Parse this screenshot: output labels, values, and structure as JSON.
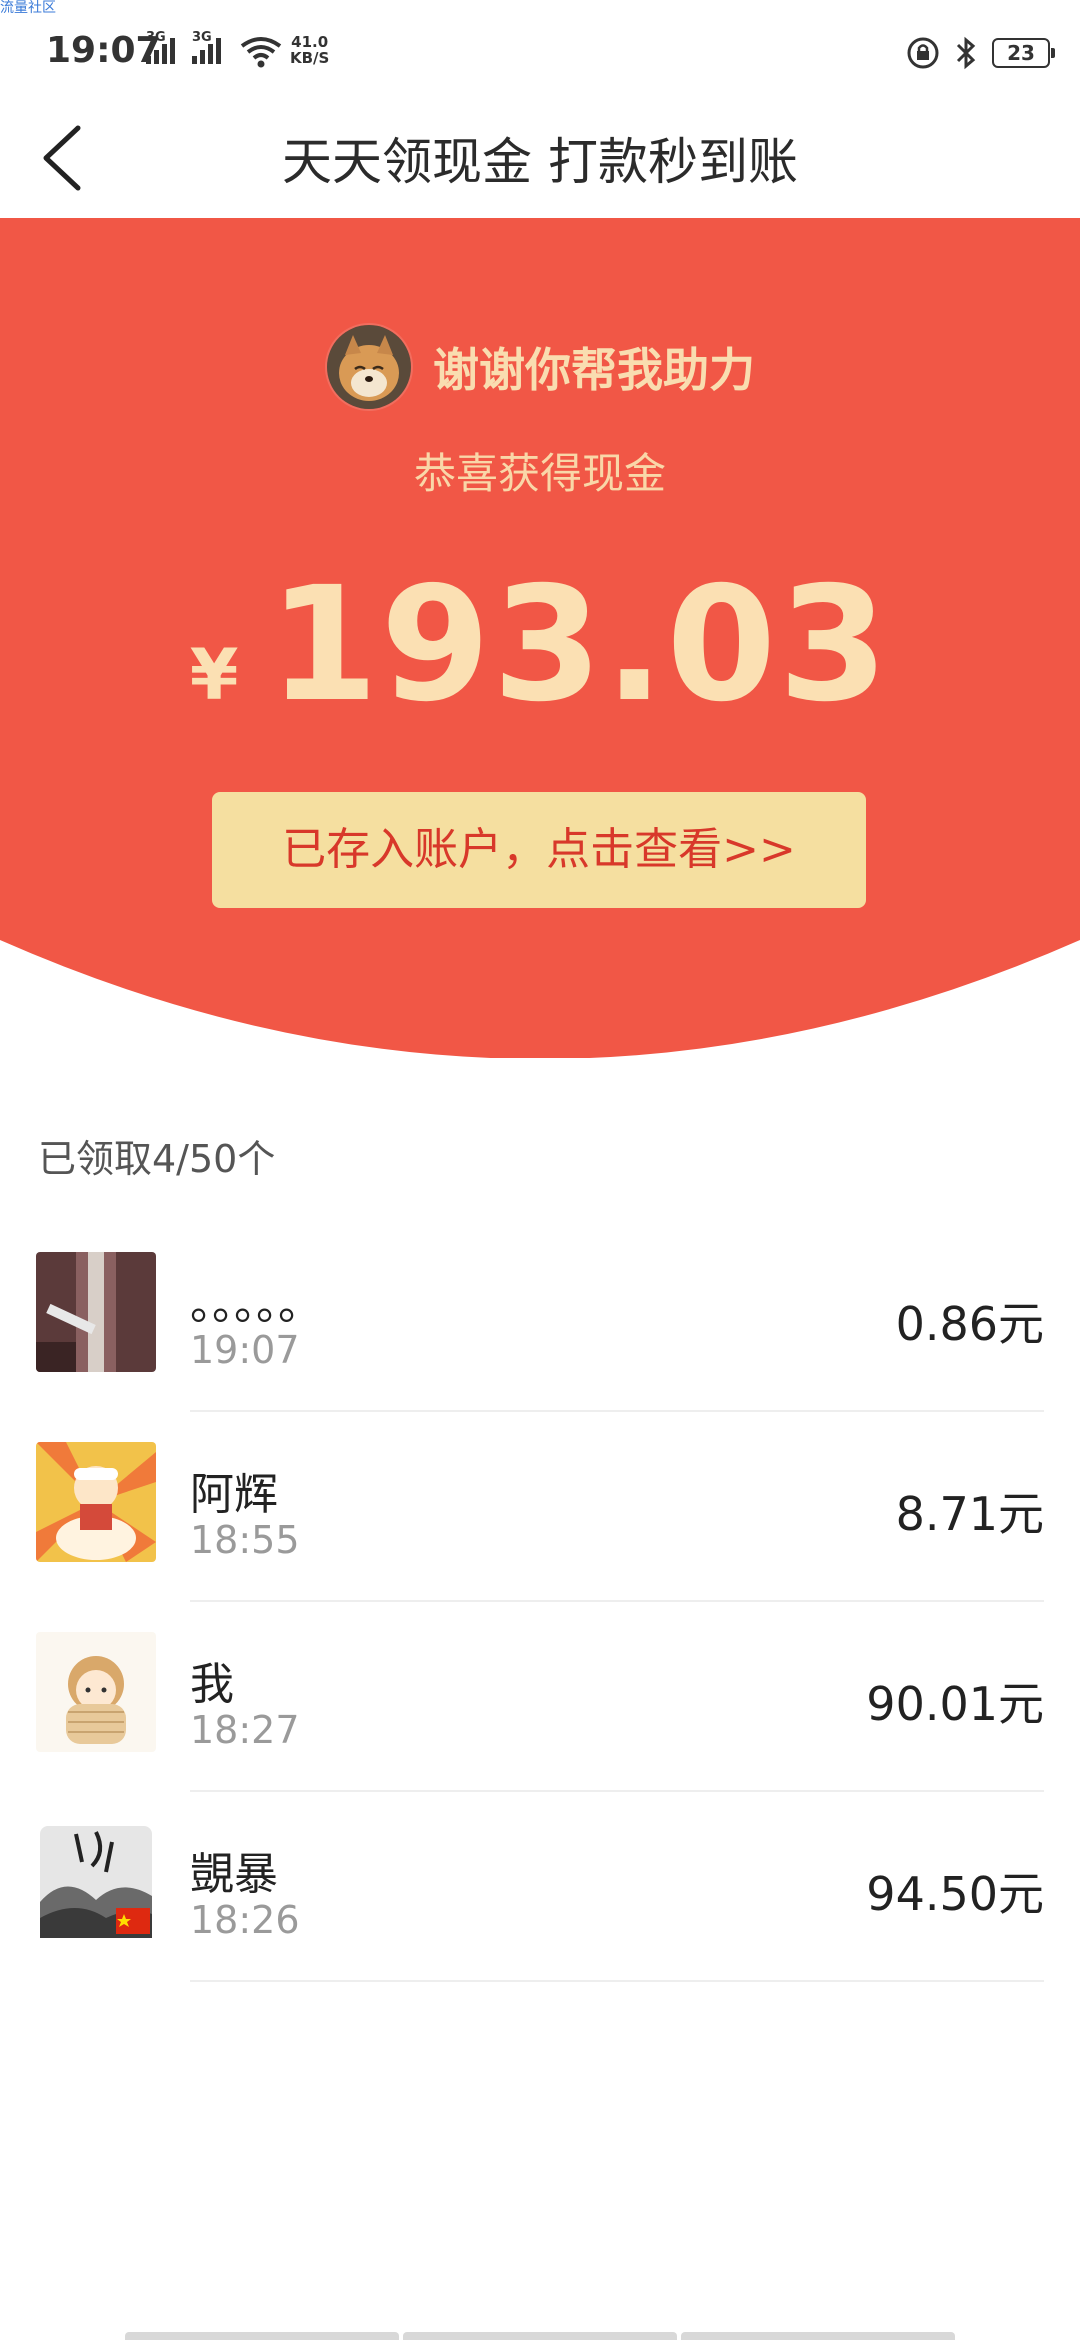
{
  "watermark": "流量社区",
  "status_bar": {
    "time": "19:07",
    "signal1_label": "3G",
    "signal2_label": "3G",
    "speed_value": "41.0",
    "speed_unit": "KB/S",
    "battery": "23"
  },
  "header": {
    "title": "天天领现金 打款秒到账"
  },
  "hero": {
    "thanks_text": "谢谢你帮我助力",
    "subtitle": "恭喜获得现金",
    "currency": "¥",
    "amount": "193.03",
    "view_button_label": "已存入账户，点击查看>>"
  },
  "list": {
    "received_label": "已领取4/50个",
    "items": [
      {
        "name": "。。。。。",
        "time": "19:07",
        "amount": "0.86元"
      },
      {
        "name": "阿辉",
        "time": "18:55",
        "amount": "8.71元"
      },
      {
        "name": "我",
        "time": "18:27",
        "amount": "90.01元"
      },
      {
        "name": "覬暴",
        "time": "18:26",
        "amount": "94.50元"
      }
    ]
  },
  "colors": {
    "hero_red": "#f15746",
    "gold_text": "#fbe0b3",
    "button_bg": "#f5dfa0",
    "button_text": "#d8382a"
  }
}
